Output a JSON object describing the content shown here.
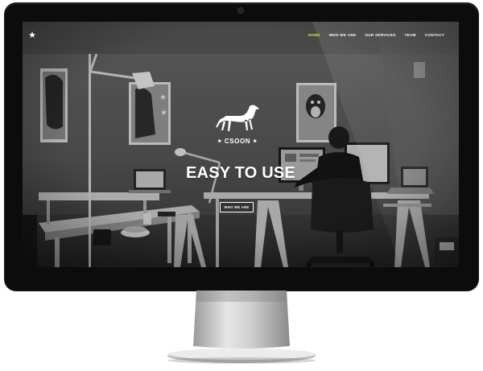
{
  "site": {
    "brand": "CSOON",
    "logo_icon": "star-icon",
    "nav": {
      "items": [
        {
          "label": "HOME",
          "active": true
        },
        {
          "label": "WHO WE ARE",
          "active": false
        },
        {
          "label": "OUR SERVICES",
          "active": false
        },
        {
          "label": "TEAM",
          "active": false
        },
        {
          "label": "CONTACT",
          "active": false
        }
      ]
    },
    "hero": {
      "headline": "EASY TO USE",
      "button_label": "WHO WE ARE",
      "brand_mark_icon": "dog-icon"
    }
  },
  "colors": {
    "nav_active": "#d9e14a",
    "nav_text": "#ffffff",
    "bezel": "#0c0c0c",
    "stand": "#c8c8c8"
  }
}
